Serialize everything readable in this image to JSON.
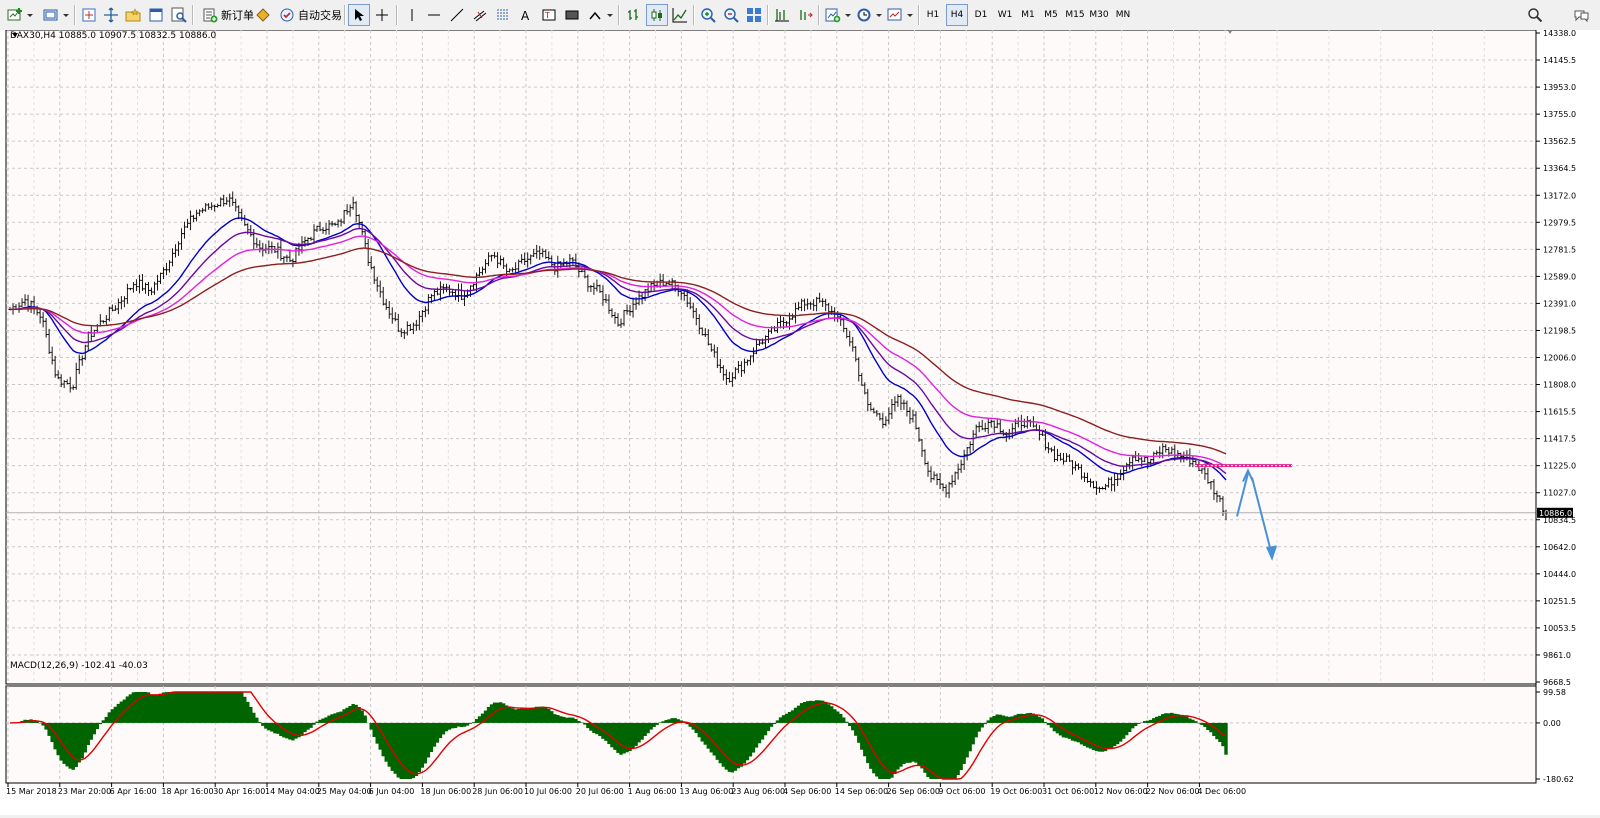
{
  "toolbar": {
    "new_order_label": "新订单",
    "auto_trading_label": "自动交易",
    "timeframes": [
      "H1",
      "H4",
      "D1",
      "W1",
      "M1",
      "M5",
      "M15",
      "M30",
      "MN"
    ],
    "active_timeframe": "H4"
  },
  "chart": {
    "symbol_label": "DAX30,H4  10885.0 10907.5 10832.5 10886.0",
    "current_price_label": "10886.0",
    "macd_label": "MACD(12,26,9) -102.41 -40.03",
    "macd_ticks": [
      "99.58",
      "0.00",
      "-180.62"
    ],
    "price_ticks": [
      "14338.0",
      "14145.5",
      "13953.0",
      "13755.0",
      "13562.5",
      "13364.5",
      "13172.0",
      "12979.5",
      "12781.5",
      "12589.0",
      "12391.0",
      "12198.5",
      "12006.0",
      "11808.0",
      "11615.5",
      "11417.5",
      "11225.0",
      "11027.0",
      "10834.5",
      "10642.0",
      "10444.0",
      "10251.5",
      "10053.5",
      "9861.0",
      "9668.5"
    ],
    "time_ticks": [
      "15 Mar 2018",
      "23 Mar 20:00",
      "6 Apr 16:00",
      "18 Apr 16:00",
      "30 Apr 16:00",
      "14 May 04:00",
      "25 May 04:00",
      "6 Jun 04:00",
      "18 Jun 06:00",
      "28 Jun 06:00",
      "10 Jul 06:00",
      "20 Jul 06:00",
      "1 Aug 06:00",
      "13 Aug 06:00",
      "23 Aug 06:00",
      "4 Sep 06:00",
      "14 Sep 06:00",
      "26 Sep 06:00",
      "9 Oct 06:00",
      "19 Oct 06:00",
      "31 Oct 06:00",
      "12 Nov 06:00",
      "22 Nov 06:00",
      "4 Dec 06:00"
    ],
    "colors": {
      "background": "#fffafa",
      "candle": "#000000",
      "ma_blue": "#0000c8",
      "ma_purple": "#6a0aa0",
      "ma_magenta": "#e020e0",
      "ma_brown": "#8b2020",
      "macd_hist": "#006400",
      "macd_signal": "#e00000",
      "arrow": "#4a90d9",
      "hline": "#e0208a"
    }
  },
  "chart_data": {
    "type": "candlestick",
    "title": "DAX30,H4",
    "ylim": [
      9668.5,
      14338.0
    ],
    "last_ohlc": {
      "open": 10885.0,
      "high": 10907.5,
      "low": 10832.5,
      "close": 10886.0
    },
    "x_tick_labels": [
      "15 Mar 2018",
      "23 Mar 20:00",
      "6 Apr 16:00",
      "18 Apr 16:00",
      "30 Apr 16:00",
      "14 May 04:00",
      "25 May 04:00",
      "6 Jun 04:00",
      "18 Jun 06:00",
      "28 Jun 06:00",
      "10 Jul 06:00",
      "20 Jul 06:00",
      "1 Aug 06:00",
      "13 Aug 06:00",
      "23 Aug 06:00",
      "4 Sep 06:00",
      "14 Sep 06:00",
      "26 Sep 06:00",
      "9 Oct 06:00",
      "19 Oct 06:00",
      "31 Oct 06:00",
      "12 Nov 06:00",
      "22 Nov 06:00",
      "4 Dec 06:00"
    ],
    "price_path": [
      12350,
      12420,
      12300,
      11850,
      11800,
      12150,
      12280,
      12400,
      12550,
      12480,
      12650,
      12900,
      13050,
      13100,
      13150,
      12950,
      12800,
      12780,
      12700,
      12850,
      12950,
      12950,
      13150,
      12700,
      12400,
      12200,
      12250,
      12450,
      12500,
      12450,
      12600,
      12750,
      12600,
      12700,
      12750,
      12650,
      12700,
      12550,
      12450,
      12250,
      12400,
      12500,
      12550,
      12500,
      12300,
      12050,
      11850,
      11950,
      12100,
      12200,
      12300,
      12400,
      12400,
      12300,
      12100,
      11650,
      11550,
      11700,
      11550,
      11150,
      11050,
      11250,
      11500,
      11550,
      11450,
      11550,
      11450,
      11300,
      11250,
      11150,
      11050,
      11150,
      11300,
      11250,
      11350,
      11300,
      11250,
      11100,
      10886
    ],
    "hline_level": 11225,
    "indicator": {
      "name": "MACD(12,26,9)",
      "main": -102.41,
      "signal": -40.03,
      "ylim": [
        -180.62,
        99.58
      ]
    }
  }
}
